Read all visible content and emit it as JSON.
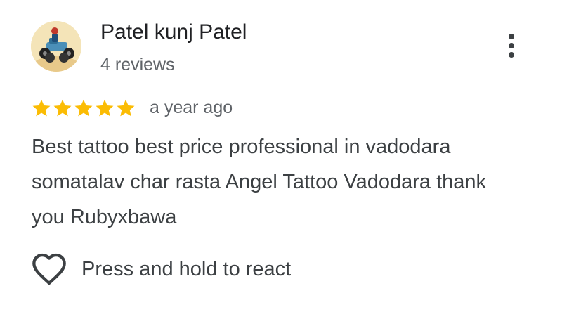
{
  "reviewer": {
    "name": "Patel kunj Patel",
    "review_count": "4 reviews",
    "avatar_icon": "atv-quad-bike-avatar"
  },
  "menu": {
    "icon": "more-vert-icon"
  },
  "review": {
    "rating": 5,
    "max_rating": 5,
    "time": "a year ago",
    "text": "Best tattoo best price professional in vadodara somatalav char rasta Angel Tattoo Vadodara thank you Rubyxbawa"
  },
  "react": {
    "icon": "heart-outline-icon",
    "label": "Press and hold to react"
  },
  "colors": {
    "star": "#fbbc04",
    "primary_text": "#202124",
    "secondary_text": "#5f6368",
    "body_text": "#3c4043"
  }
}
